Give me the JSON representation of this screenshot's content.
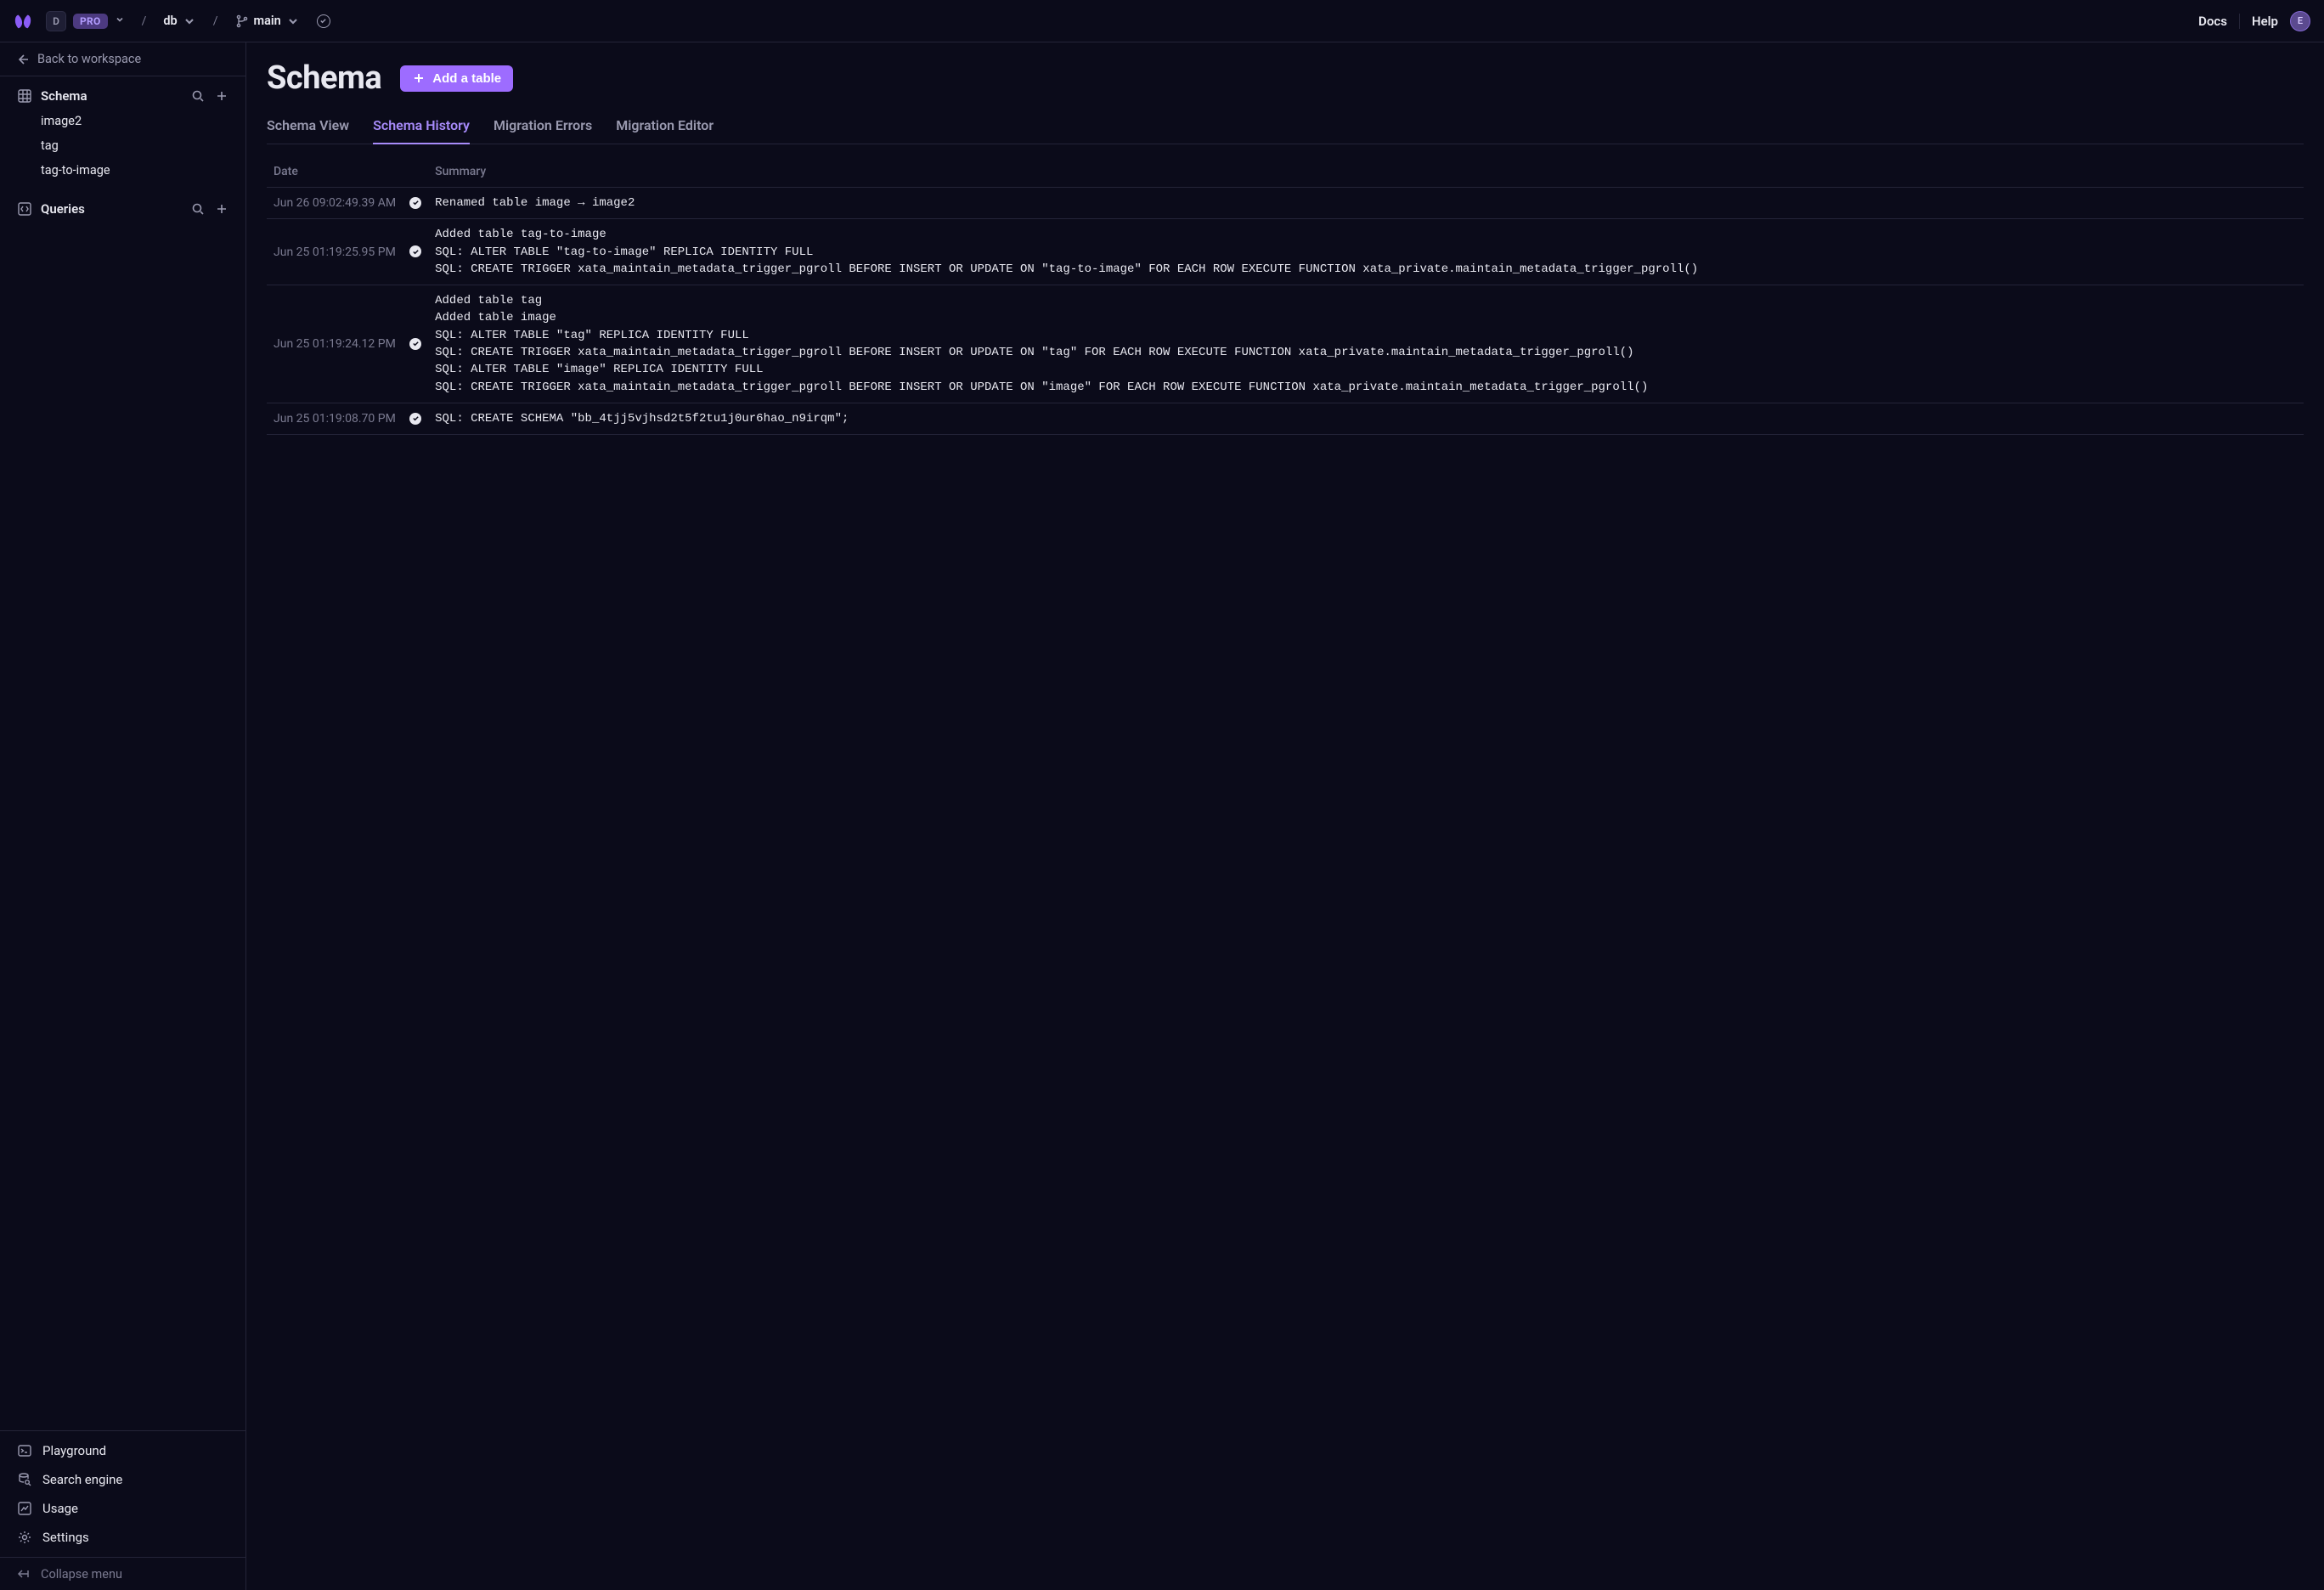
{
  "topbar": {
    "workspace_initial": "D",
    "pro_label": "PRO",
    "db_label": "db",
    "branch_label": "main",
    "docs_label": "Docs",
    "help_label": "Help",
    "avatar_initial": "E"
  },
  "sidebar": {
    "back_label": "Back to workspace",
    "schema": {
      "header": "Schema",
      "items": [
        "image2",
        "tag",
        "tag-to-image"
      ]
    },
    "queries": {
      "header": "Queries"
    },
    "bottom": {
      "playground": "Playground",
      "search": "Search engine",
      "usage": "Usage",
      "settings": "Settings"
    },
    "collapse_label": "Collapse menu"
  },
  "main": {
    "title": "Schema",
    "add_table_label": "Add a table",
    "tabs": {
      "view": "Schema View",
      "history": "Schema History",
      "errors": "Migration Errors",
      "editor": "Migration Editor"
    },
    "columns": {
      "date": "Date",
      "summary": "Summary"
    },
    "rows": [
      {
        "date": "Jun 26 09:02:49.39 AM",
        "summary": "Renamed table image → image2"
      },
      {
        "date": "Jun 25 01:19:25.95 PM",
        "summary": "Added table tag-to-image\nSQL: ALTER TABLE \"tag-to-image\" REPLICA IDENTITY FULL\nSQL: CREATE TRIGGER xata_maintain_metadata_trigger_pgroll BEFORE INSERT OR UPDATE ON \"tag-to-image\" FOR EACH ROW EXECUTE FUNCTION xata_private.maintain_metadata_trigger_pgroll()"
      },
      {
        "date": "Jun 25 01:19:24.12 PM",
        "summary": "Added table tag\nAdded table image\nSQL: ALTER TABLE \"tag\" REPLICA IDENTITY FULL\nSQL: CREATE TRIGGER xata_maintain_metadata_trigger_pgroll BEFORE INSERT OR UPDATE ON \"tag\" FOR EACH ROW EXECUTE FUNCTION xata_private.maintain_metadata_trigger_pgroll()\nSQL: ALTER TABLE \"image\" REPLICA IDENTITY FULL\nSQL: CREATE TRIGGER xata_maintain_metadata_trigger_pgroll BEFORE INSERT OR UPDATE ON \"image\" FOR EACH ROW EXECUTE FUNCTION xata_private.maintain_metadata_trigger_pgroll()"
      },
      {
        "date": "Jun 25 01:19:08.70 PM",
        "summary": "SQL: CREATE SCHEMA \"bb_4tjj5vjhsd2t5f2tu1j0ur6hao_n9irqm\";"
      }
    ]
  }
}
